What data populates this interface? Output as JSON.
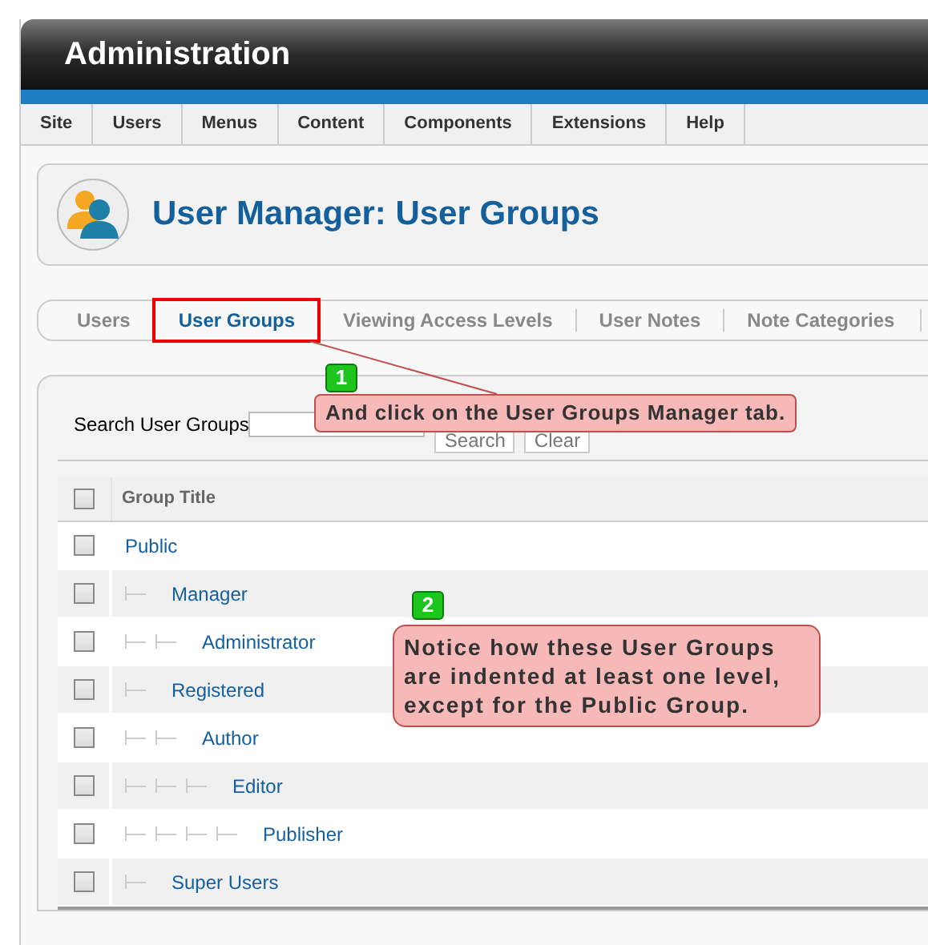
{
  "header": {
    "title": "Administration"
  },
  "menu": [
    {
      "label": "Site"
    },
    {
      "label": "Users"
    },
    {
      "label": "Menus"
    },
    {
      "label": "Content"
    },
    {
      "label": "Components"
    },
    {
      "label": "Extensions"
    },
    {
      "label": "Help"
    }
  ],
  "page_title": "User Manager: User Groups",
  "tabs": [
    {
      "label": "Users",
      "selected": false
    },
    {
      "label": "User Groups",
      "selected": true
    },
    {
      "label": "Viewing Access Levels",
      "selected": false
    },
    {
      "label": "User Notes",
      "selected": false
    },
    {
      "label": "Note Categories",
      "selected": false
    }
  ],
  "search": {
    "label": "Search User Groups",
    "buttons": [
      "Search",
      "Clear"
    ]
  },
  "table": {
    "columns": [
      "Group Title"
    ],
    "header_checked": false,
    "rows": [
      {
        "title": "Public",
        "checked": false,
        "children": [
          {
            "title": "Manager",
            "checked": false,
            "children": [
              {
                "title": "Administrator",
                "checked": false
              }
            ]
          },
          {
            "title": "Registered",
            "checked": false,
            "children": [
              {
                "title": "Author",
                "checked": false,
                "children": [
                  {
                    "title": "Editor",
                    "checked": false,
                    "children": [
                      {
                        "title": "Publisher",
                        "checked": false
                      }
                    ]
                  }
                ]
              }
            ]
          },
          {
            "title": "Super Users",
            "checked": false
          }
        ]
      }
    ]
  },
  "annotations": [
    {
      "number": "1",
      "text": "And click on the User Groups Manager tab."
    },
    {
      "number": "2",
      "text": "Notice how these User Groups are indented at least one level, except for the Public Group."
    }
  ]
}
